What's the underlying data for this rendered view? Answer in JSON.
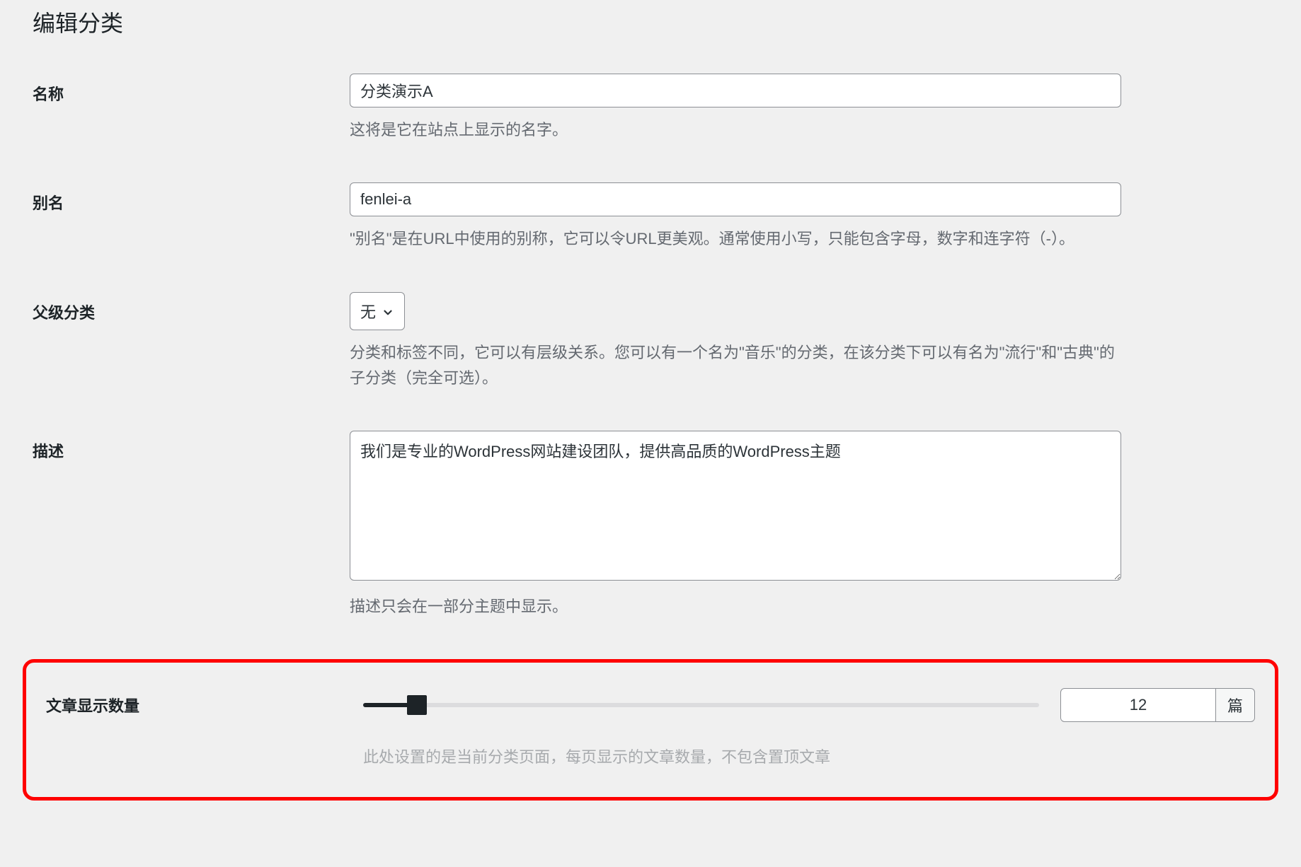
{
  "page_title": "编辑分类",
  "fields": {
    "name": {
      "label": "名称",
      "value": "分类演示A",
      "help": "这将是它在站点上显示的名字。"
    },
    "slug": {
      "label": "别名",
      "value": "fenlei-a",
      "help": "\"别名\"是在URL中使用的别称，它可以令URL更美观。通常使用小写，只能包含字母，数字和连字符（-）。"
    },
    "parent": {
      "label": "父级分类",
      "selected": "无",
      "help": "分类和标签不同，它可以有层级关系。您可以有一个名为\"音乐\"的分类，在该分类下可以有名为\"流行\"和\"古典\"的子分类（完全可选）。"
    },
    "description": {
      "label": "描述",
      "value": "我们是专业的WordPress网站建设团队，提供高品质的WordPress主题",
      "help": "描述只会在一部分主题中显示。"
    },
    "post_count": {
      "label": "文章显示数量",
      "value": "12",
      "unit": "篇",
      "help": "此处设置的是当前分类页面，每页显示的文章数量，不包含置顶文章"
    }
  }
}
